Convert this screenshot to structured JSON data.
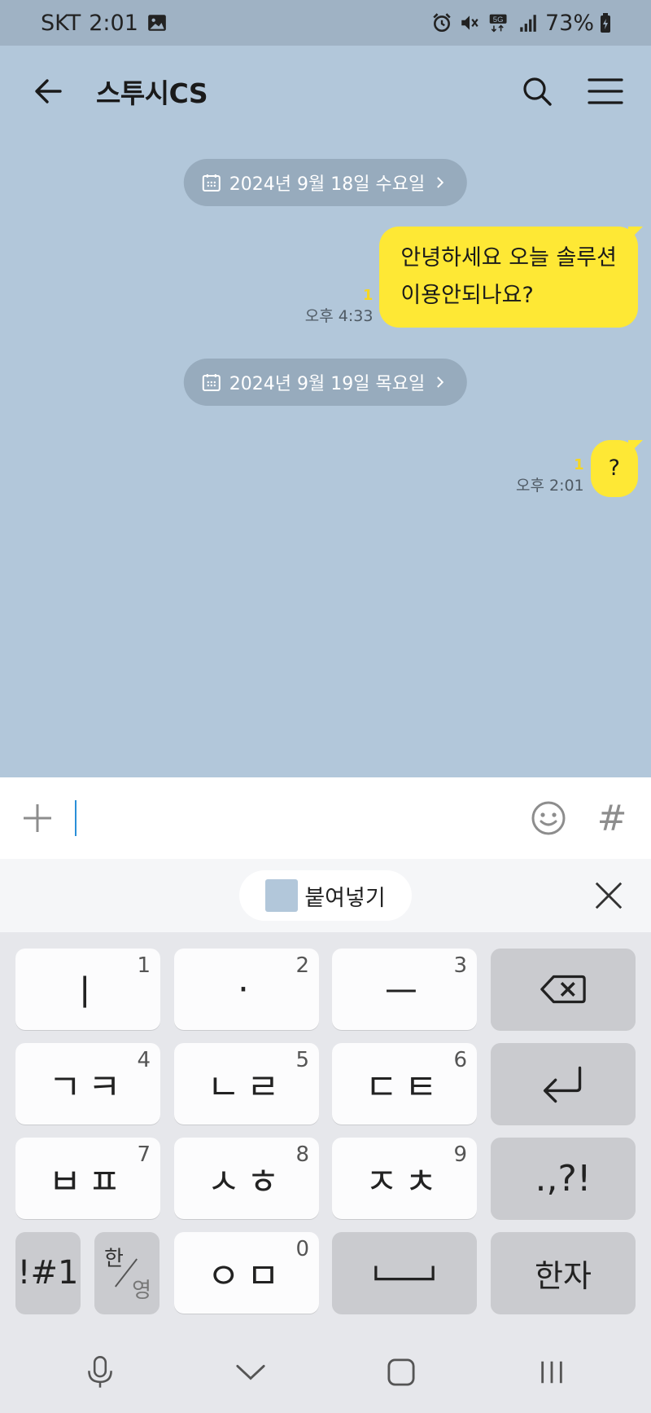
{
  "status_bar": {
    "carrier": "SKT",
    "time": "2:01",
    "network": "5G",
    "battery_percent": "73%"
  },
  "header": {
    "title": "스투시CS"
  },
  "chat": {
    "messages": [
      {
        "type": "date",
        "text": "2024년 9월 18일 수요일"
      },
      {
        "type": "sent",
        "line1": "안녕하세요 오늘 솔루션",
        "line2": "이용안되나요?",
        "unread": "1",
        "time": "오후 4:33"
      },
      {
        "type": "date",
        "text": "2024년 9월 19일 목요일"
      },
      {
        "type": "sent",
        "line1": "?",
        "unread": "1",
        "time": "오후 2:01"
      }
    ]
  },
  "input_bar": {
    "hash_label": "#"
  },
  "clipboard": {
    "paste_label": "붙여넣기"
  },
  "keyboard": {
    "rows": [
      [
        {
          "label": "ㅣ",
          "num": "1"
        },
        {
          "label": "·",
          "num": "2"
        },
        {
          "label": "ㅡ",
          "num": "3"
        },
        {
          "icon": "backspace-icon"
        }
      ],
      [
        {
          "label": "ㄱㅋ",
          "num": "4"
        },
        {
          "label": "ㄴㄹ",
          "num": "5"
        },
        {
          "label": "ㄷㅌ",
          "num": "6"
        },
        {
          "icon": "enter-icon"
        }
      ],
      [
        {
          "label": "ㅂㅍ",
          "num": "7"
        },
        {
          "label": "ㅅㅎ",
          "num": "8"
        },
        {
          "label": "ㅈㅊ",
          "num": "9"
        },
        {
          "label": ".,?!"
        }
      ],
      [
        {
          "label": "!#1"
        },
        {
          "han": "한",
          "eng": "영"
        },
        {
          "label": "ㅇㅁ",
          "num": "0"
        },
        {
          "icon": "space-icon"
        },
        {
          "label": "한자"
        }
      ]
    ]
  },
  "colors": {
    "chat_background": "#b2c7da",
    "bubble_yellow": "#fee835",
    "date_chip": "#97abbd",
    "unread_count": "#f5d623",
    "caret": "#2a8fd8"
  }
}
